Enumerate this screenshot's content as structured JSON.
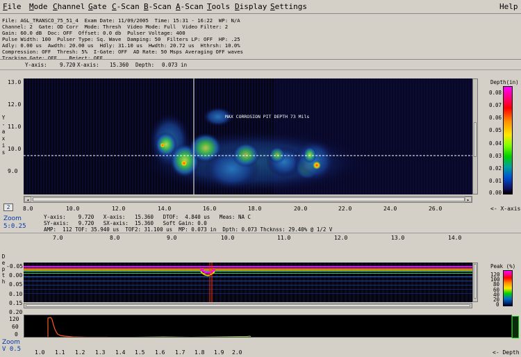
{
  "menu": {
    "items": [
      {
        "label": "File",
        "u": "F"
      },
      {
        "label": "Mode",
        "u": "M"
      },
      {
        "label": "Channel",
        "u": "C"
      },
      {
        "label": "Gate",
        "u": "G"
      },
      {
        "label": "C-Scan",
        "u": "C"
      },
      {
        "label": "B-Scan",
        "u": "B"
      },
      {
        "label": "A-Scan",
        "u": "A"
      },
      {
        "label": "Tools",
        "u": "T"
      },
      {
        "label": "Display",
        "u": "D"
      },
      {
        "label": "Settings",
        "u": "S"
      }
    ],
    "help": "Help"
  },
  "info_lines": [
    "File: AGL_TRANSCO_75_51_4  Exam Date: 11/09/2005  Time: 15:31 - 16:22  WP: N/A",
    "Channel: 2  Gate: OD Corr  Mode: Thresh  Video Mode: Full  Video Filter: 2",
    "Gain: 60.0 dB  Doc: OFF  Offset: 0.0 db  Pulser Voltage: 400",
    "Pulse Width: 100  Pulser Type: Sq. Wave  Damping: 50  Filters LP: OFF  HP: .25",
    "Adly: 0.00 us  Awdth: 20.00 us  Hdly: 31.10 us  Hwdth: 20.72 us  Hthrsh: 10.0%",
    "Compression: OFF  Thresh: 5%  I-Gate: OFF  AD Rate: 50 Msps Averaging OFF waves",
    "Tracking Gate: OFF    Reject: OFF"
  ],
  "cursor_readout": {
    "y_label": "Y-axis:",
    "y_value": "9.720",
    "x_label": "X-axis:",
    "x_value": "15.360",
    "depth_label": "Depth:",
    "depth_value": "0.073 in"
  },
  "cscan": {
    "y_axis_title": "Y-axis",
    "y_ticks": [
      "13.0",
      "12.0",
      "11.0",
      "10.0",
      "9.0"
    ],
    "x_ticks": [
      "8.0",
      "10.0",
      "12.0",
      "14.0",
      "16.0",
      "18.0",
      "20.0",
      "22.0",
      "24.0",
      "26.0"
    ],
    "x_axis_label": "<- X-axis",
    "annotation": "MAX CORROSION PIT DEPTH 73 Mils",
    "page_box": "2",
    "zoom_label": "Zoom",
    "zoom_value": "5:0.25",
    "legend_title": "Depth(in)",
    "legend_ticks": [
      "0.08",
      "0.07",
      "0.06",
      "0.05",
      "0.04",
      "0.03",
      "0.02",
      "0.01",
      "0.00"
    ]
  },
  "bscan_readout": {
    "line1": "Y-axis:    9.720   X-axis:   15.360   DTOF:  4.840 us   Meas: NA C",
    "line2": "SY-axis:   9.720   SX-axis:  15.360   Soft Gain: 0.0",
    "line3": "AMP:  112 TOF: 35.940 us  TOF2: 31.100 us  MP: 0.073 in  Dpth: 0.073 Thcknss: 29.40% @ 1/2 V"
  },
  "bscan": {
    "top_ticks": [
      "7.0",
      "8.0",
      "9.0",
      "10.0",
      "11.0",
      "12.0",
      "13.0",
      "14.0"
    ],
    "y_axis_title": "Depth",
    "y_ticks": [
      "-0.05",
      "0.00",
      "0.05",
      "0.10",
      "0.15",
      "0.20"
    ],
    "legend_title": "Peak (%)",
    "legend_ticks": [
      "120",
      "100",
      "80",
      "60",
      "40",
      "20",
      "0"
    ]
  },
  "ascan": {
    "y_ticks": [
      "120",
      "60",
      "0"
    ],
    "x_ticks": [
      "1.0",
      "1.1",
      "1.2",
      "1.3",
      "1.4",
      "1.5",
      "1.6",
      "1.7",
      "1.8",
      "1.9",
      "2.0"
    ],
    "zoom_label": "Zoom",
    "zoom_value": "V 0.5",
    "x_axis_label": "<- Depth"
  },
  "colors": {
    "background": "#d4d0c8",
    "plot_bg": "#000000",
    "zoom_text": "#0037a8",
    "gate_red": "#ff2a00",
    "signal_green": "#a6e05a"
  }
}
